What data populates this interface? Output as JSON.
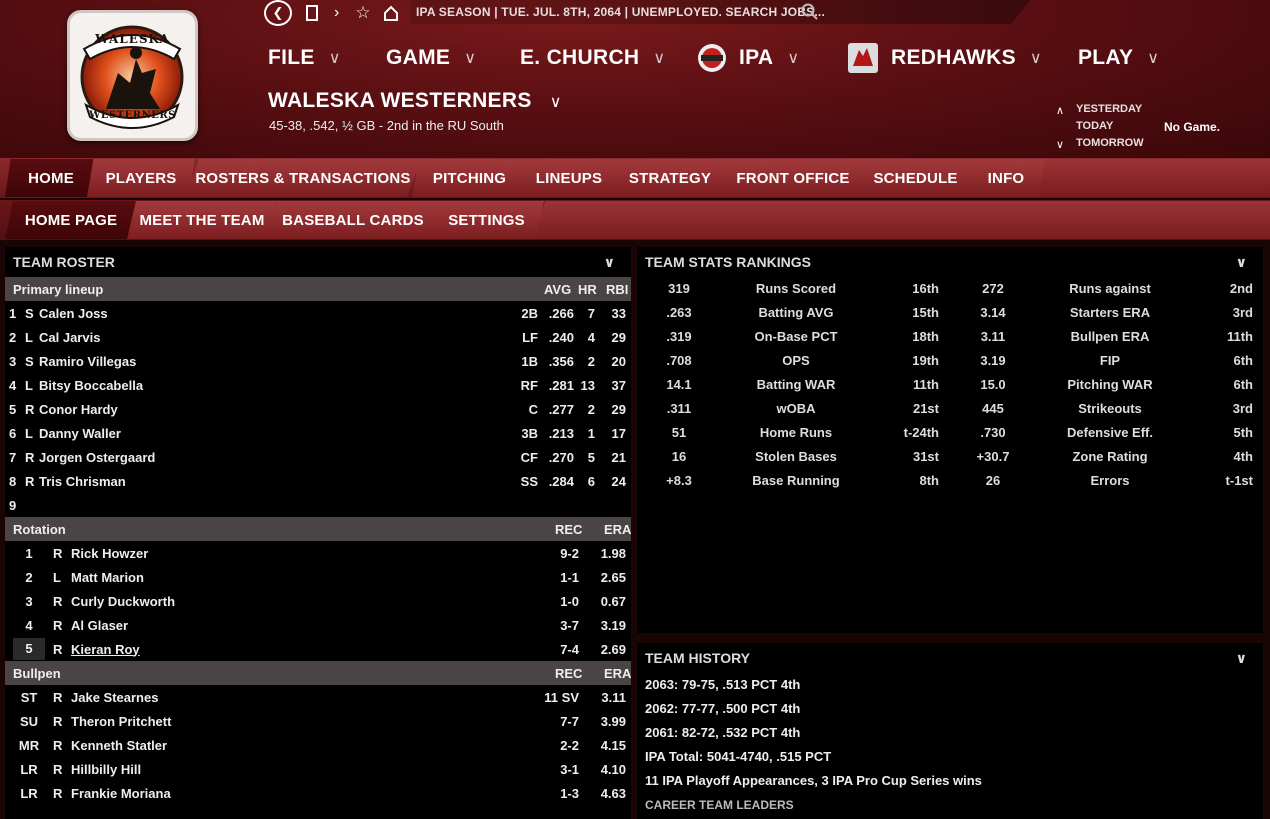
{
  "topbar": {
    "status": "IPA SEASON  |  TUE. JUL. 8TH, 2064  |  UNEMPLOYED. SEARCH JOBS..."
  },
  "menu": {
    "file": "FILE",
    "game": "GAME",
    "church": "E. CHURCH",
    "ipa": "IPA",
    "redhawks": "REDHAWKS",
    "play": "PLAY"
  },
  "team": {
    "name": "WALESKA WESTERNERS",
    "record": "45-38, .542, ½ GB - 2nd in the RU South",
    "logo_text_top": "WALESKA",
    "logo_text_bottom": "WESTERNERS"
  },
  "daynav": {
    "yesterday": "YESTERDAY",
    "today": "TODAY",
    "tomorrow": "TOMORROW",
    "today_status": "No Game."
  },
  "tabs": [
    "HOME",
    "PLAYERS",
    "ROSTERS & TRANSACTIONS",
    "PITCHING",
    "LINEUPS",
    "STRATEGY",
    "FRONT OFFICE",
    "SCHEDULE",
    "INFO"
  ],
  "subtabs": [
    "HOME PAGE",
    "MEET THE TEAM",
    "BASEBALL CARDS",
    "SETTINGS"
  ],
  "roster": {
    "title": "TEAM ROSTER",
    "lineup_header": {
      "label": "Primary lineup",
      "avg": "AVG",
      "hr": "HR",
      "rbi": "RBI"
    },
    "lineup": [
      {
        "num": "1",
        "hand": "S",
        "name": "Calen Joss",
        "pos": "2B",
        "avg": ".266",
        "hr": "7",
        "rbi": "33"
      },
      {
        "num": "2",
        "hand": "L",
        "name": "Cal Jarvis",
        "pos": "LF",
        "avg": ".240",
        "hr": "4",
        "rbi": "29"
      },
      {
        "num": "3",
        "hand": "S",
        "name": "Ramiro Villegas",
        "pos": "1B",
        "avg": ".356",
        "hr": "2",
        "rbi": "20"
      },
      {
        "num": "4",
        "hand": "L",
        "name": "Bitsy Boccabella",
        "pos": "RF",
        "avg": ".281",
        "hr": "13",
        "rbi": "37"
      },
      {
        "num": "5",
        "hand": "R",
        "name": "Conor Hardy",
        "pos": "C",
        "avg": ".277",
        "hr": "2",
        "rbi": "29"
      },
      {
        "num": "6",
        "hand": "L",
        "name": "Danny Waller",
        "pos": "3B",
        "avg": ".213",
        "hr": "1",
        "rbi": "17"
      },
      {
        "num": "7",
        "hand": "R",
        "name": "Jorgen Ostergaard",
        "pos": "CF",
        "avg": ".270",
        "hr": "5",
        "rbi": "21"
      },
      {
        "num": "8",
        "hand": "R",
        "name": "Tris Chrisman",
        "pos": "SS",
        "avg": ".284",
        "hr": "6",
        "rbi": "24"
      },
      {
        "num": "9",
        "hand": "",
        "name": "",
        "pos": "",
        "avg": "",
        "hr": "",
        "rbi": ""
      }
    ],
    "rotation_header": {
      "label": "Rotation",
      "rec": "REC",
      "era": "ERA"
    },
    "rotation": [
      {
        "num": "1",
        "hand": "R",
        "name": "Rick Howzer",
        "rec": "9-2",
        "era": "1.98"
      },
      {
        "num": "2",
        "hand": "L",
        "name": "Matt Marion",
        "rec": "1-1",
        "era": "2.65"
      },
      {
        "num": "3",
        "hand": "R",
        "name": "Curly Duckworth",
        "rec": "1-0",
        "era": "0.67"
      },
      {
        "num": "4",
        "hand": "R",
        "name": "Al Glaser",
        "rec": "3-7",
        "era": "3.19"
      },
      {
        "num": "5",
        "hand": "R",
        "name": "Kieran Roy",
        "rec": "7-4",
        "era": "2.69"
      }
    ],
    "bullpen_header": {
      "label": "Bullpen",
      "rec": "REC",
      "era": "ERA"
    },
    "bullpen": [
      {
        "role": "ST",
        "hand": "R",
        "name": "Jake Stearnes",
        "rec": "11 SV",
        "era": "3.11"
      },
      {
        "role": "SU",
        "hand": "R",
        "name": "Theron Pritchett",
        "rec": "7-7",
        "era": "3.99"
      },
      {
        "role": "MR",
        "hand": "R",
        "name": "Kenneth Statler",
        "rec": "2-2",
        "era": "4.15"
      },
      {
        "role": "LR",
        "hand": "R",
        "name": "Hillbilly Hill",
        "rec": "3-1",
        "era": "4.10"
      },
      {
        "role": "LR",
        "hand": "R",
        "name": "Frankie Moriana",
        "rec": "1-3",
        "era": "4.63"
      }
    ]
  },
  "stats": {
    "title": "TEAM STATS RANKINGS",
    "rows": [
      {
        "v1": "319",
        "l1": "Runs Scored",
        "r1": "16th",
        "v2": "272",
        "l2": "Runs against",
        "r2": "2nd"
      },
      {
        "v1": ".263",
        "l1": "Batting AVG",
        "r1": "15th",
        "v2": "3.14",
        "l2": "Starters ERA",
        "r2": "3rd"
      },
      {
        "v1": ".319",
        "l1": "On-Base PCT",
        "r1": "18th",
        "v2": "3.11",
        "l2": "Bullpen ERA",
        "r2": "11th"
      },
      {
        "v1": ".708",
        "l1": "OPS",
        "r1": "19th",
        "v2": "3.19",
        "l2": "FIP",
        "r2": "6th"
      },
      {
        "v1": "14.1",
        "l1": "Batting WAR",
        "r1": "11th",
        "v2": "15.0",
        "l2": "Pitching WAR",
        "r2": "6th"
      },
      {
        "v1": ".311",
        "l1": "wOBA",
        "r1": "21st",
        "v2": "445",
        "l2": "Strikeouts",
        "r2": "3rd"
      },
      {
        "v1": "51",
        "l1": "Home Runs",
        "r1": "t-24th",
        "v2": ".730",
        "l2": "Defensive Eff.",
        "r2": "5th"
      },
      {
        "v1": "16",
        "l1": "Stolen Bases",
        "r1": "31st",
        "v2": "+30.7",
        "l2": "Zone Rating",
        "r2": "4th"
      },
      {
        "v1": "+8.3",
        "l1": "Base Running",
        "r1": "8th",
        "v2": "26",
        "l2": "Errors",
        "r2": "t-1st"
      }
    ]
  },
  "history": {
    "title": "TEAM HISTORY",
    "lines": [
      "2063: 79-75, .513 PCT 4th",
      "2062: 77-77, .500 PCT 4th",
      "2061: 82-72, .532 PCT 4th",
      "IPA Total: 5041-4740, .515 PCT",
      "11 IPA Playoff Appearances, 3 IPA Pro Cup Series wins"
    ],
    "leaders_label": "CAREER TEAM LEADERS"
  },
  "colors": {
    "header_bg": "#5a0f12",
    "tab_active": "#3e0507",
    "panel_bg": "#000000",
    "section_bar": "#4a4444"
  }
}
